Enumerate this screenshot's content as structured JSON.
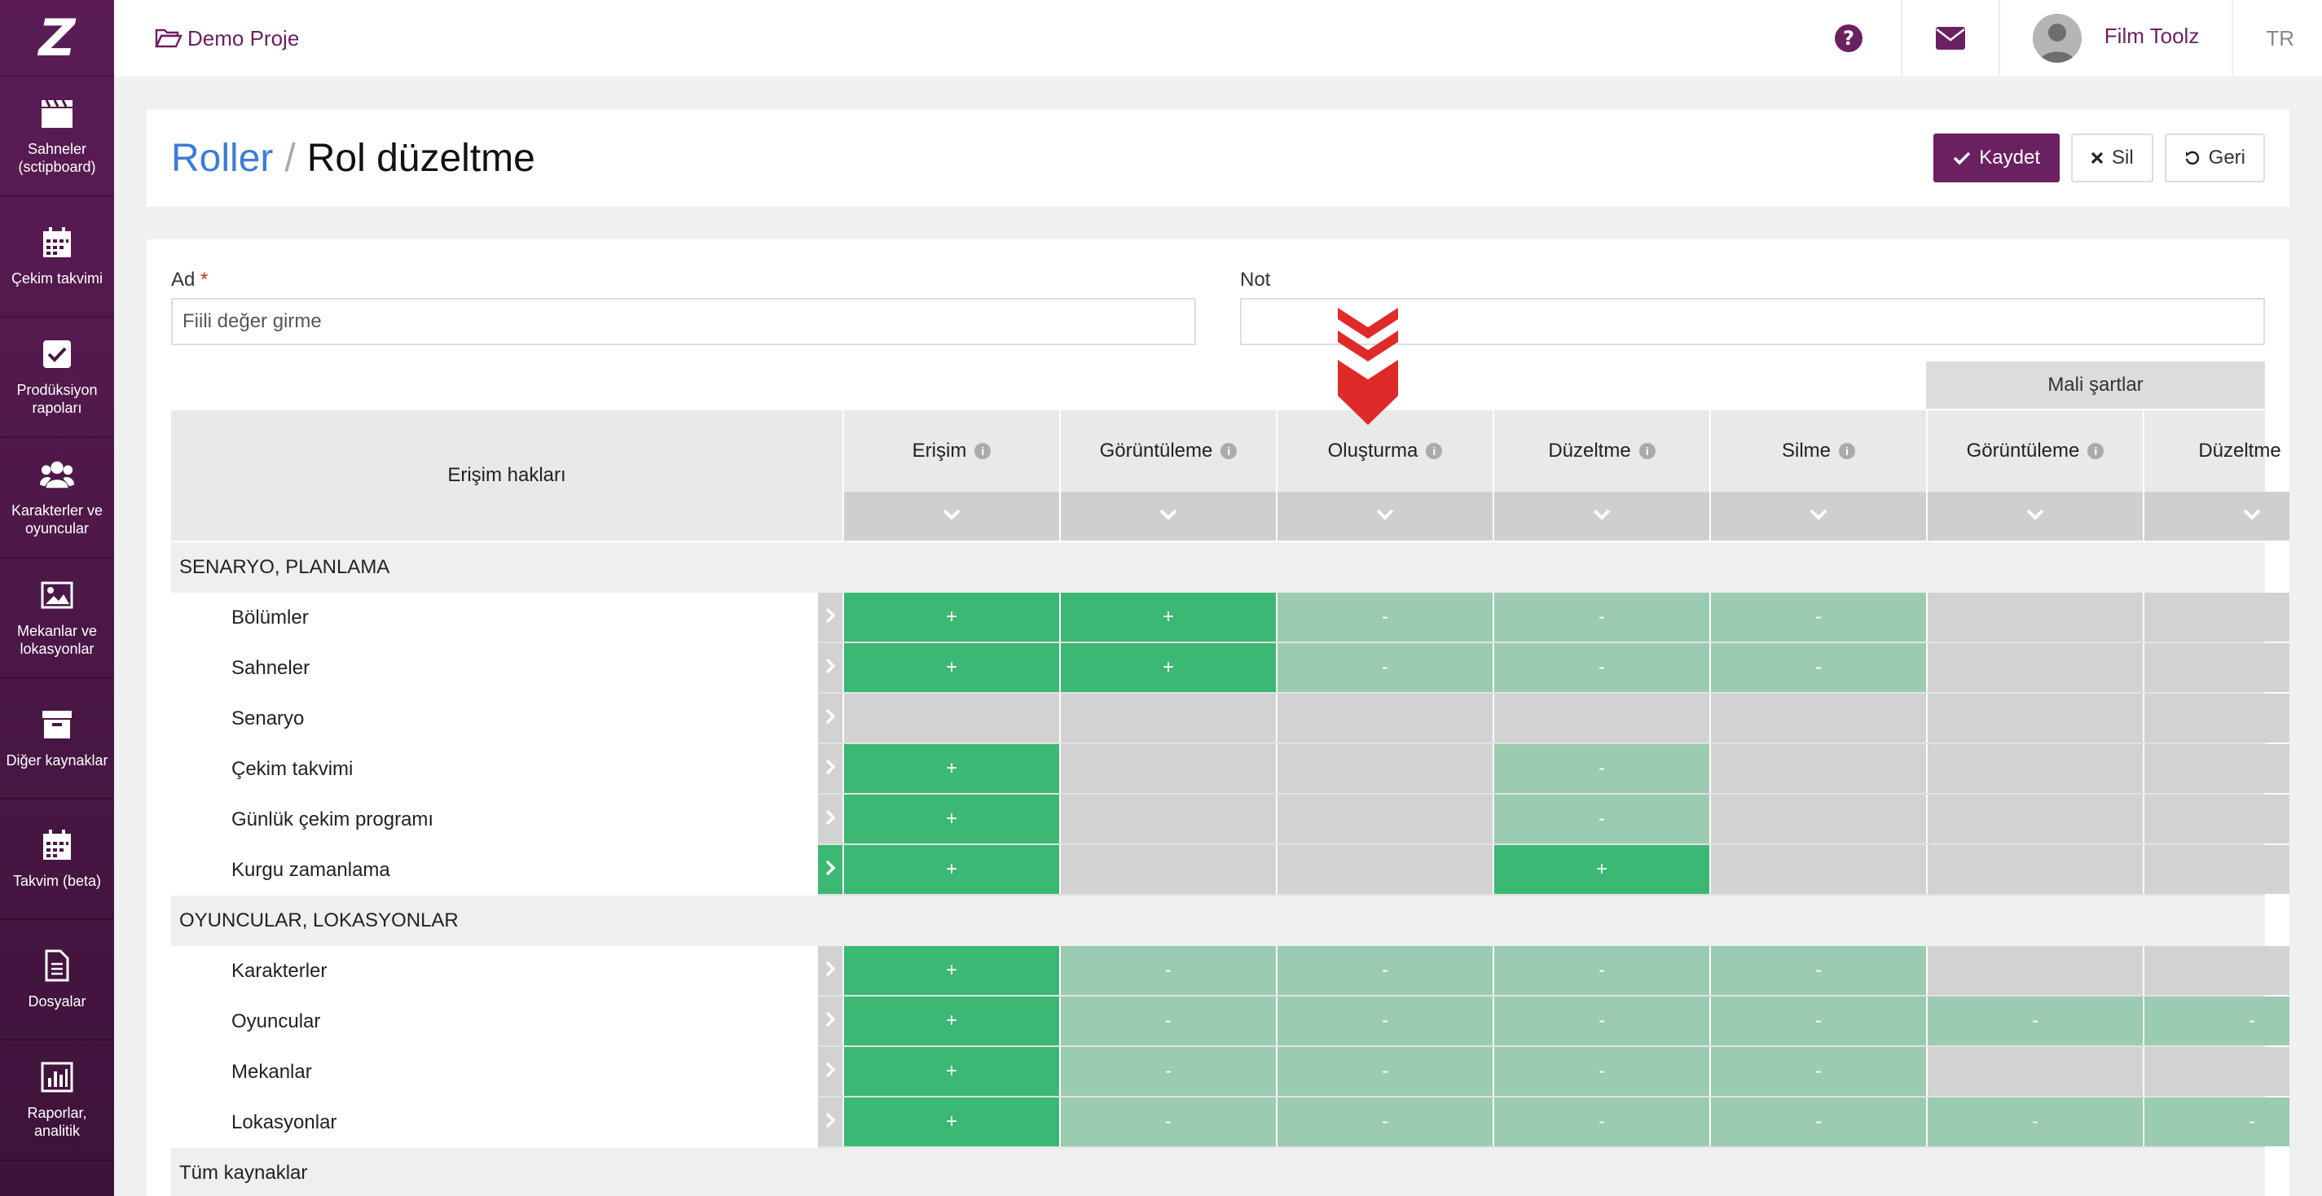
{
  "app": {
    "logo": "Z"
  },
  "sidebar": {
    "items": [
      {
        "label": "Sahneler (sctipboard)",
        "icon": "clapperboard-icon"
      },
      {
        "label": "Çekim takvimi",
        "icon": "calendar-icon"
      },
      {
        "label": "Prodüksiyon rapoları",
        "icon": "checkbox-icon"
      },
      {
        "label": "Karakterler ve oyuncular",
        "icon": "users-icon"
      },
      {
        "label": "Mekanlar ve lokasyonlar",
        "icon": "image-icon"
      },
      {
        "label": "Diğer kaynaklar",
        "icon": "archive-icon"
      },
      {
        "label": "Takvim (beta)",
        "icon": "calendar-icon"
      },
      {
        "label": "Dosyalar",
        "icon": "file-icon"
      },
      {
        "label": "Raporlar, analitik",
        "icon": "bar-chart-icon"
      }
    ]
  },
  "topbar": {
    "project": "Demo Proje",
    "user_name": "Film Toolz",
    "lang": "TR"
  },
  "title": {
    "breadcrumb_link": "Roller",
    "separator": "/",
    "current": "Rol düzeltme"
  },
  "actions": {
    "save": "Kaydet",
    "delete": "Sil",
    "back": "Geri"
  },
  "form": {
    "name_label": "Ad",
    "name_required": "*",
    "name_value": "Fiili değer girme",
    "note_label": "Not",
    "note_value": ""
  },
  "table": {
    "group_header": "Mali şartlar",
    "row_header": "Erişim hakları",
    "columns": [
      "Erişim",
      "Görüntüleme",
      "Oluşturma",
      "Düzeltme",
      "Silme",
      "Görüntüleme",
      "Düzeltme"
    ],
    "sections": [
      {
        "title": "SENARYO, PLANLAMA",
        "rows": [
          {
            "label": "Bölümler",
            "active": false,
            "cells": [
              [
                "on",
                "+"
              ],
              [
                "on",
                "+"
              ],
              [
                "dim",
                "-"
              ],
              [
                "dim",
                "-"
              ],
              [
                "dim",
                "-"
              ],
              [
                "off",
                ""
              ],
              [
                "off",
                ""
              ]
            ]
          },
          {
            "label": "Sahneler",
            "active": false,
            "cells": [
              [
                "on",
                "+"
              ],
              [
                "on",
                "+"
              ],
              [
                "dim",
                "-"
              ],
              [
                "dim",
                "-"
              ],
              [
                "dim",
                "-"
              ],
              [
                "off",
                ""
              ],
              [
                "off",
                ""
              ]
            ]
          },
          {
            "label": "Senaryo",
            "active": false,
            "cells": [
              [
                "off",
                ""
              ],
              [
                "off",
                ""
              ],
              [
                "off",
                ""
              ],
              [
                "off",
                ""
              ],
              [
                "off",
                ""
              ],
              [
                "off",
                ""
              ],
              [
                "off",
                ""
              ]
            ]
          },
          {
            "label": "Çekim takvimi",
            "active": false,
            "cells": [
              [
                "on",
                "+"
              ],
              [
                "off",
                ""
              ],
              [
                "off",
                ""
              ],
              [
                "dim",
                "-"
              ],
              [
                "off",
                ""
              ],
              [
                "off",
                ""
              ],
              [
                "off",
                ""
              ]
            ]
          },
          {
            "label": "Günlük çekim programı",
            "active": false,
            "cells": [
              [
                "on",
                "+"
              ],
              [
                "off",
                ""
              ],
              [
                "off",
                ""
              ],
              [
                "dim",
                "-"
              ],
              [
                "off",
                ""
              ],
              [
                "off",
                ""
              ],
              [
                "off",
                ""
              ]
            ]
          },
          {
            "label": "Kurgu zamanlama",
            "active": true,
            "cells": [
              [
                "on",
                "+"
              ],
              [
                "off",
                ""
              ],
              [
                "off",
                ""
              ],
              [
                "on",
                "+"
              ],
              [
                "off",
                ""
              ],
              [
                "off",
                ""
              ],
              [
                "off",
                ""
              ]
            ]
          }
        ]
      },
      {
        "title": "OYUNCULAR, LOKASYONLAR",
        "rows": [
          {
            "label": "Karakterler",
            "active": false,
            "cells": [
              [
                "on",
                "+"
              ],
              [
                "dim",
                "-"
              ],
              [
                "dim",
                "-"
              ],
              [
                "dim",
                "-"
              ],
              [
                "dim",
                "-"
              ],
              [
                "off",
                ""
              ],
              [
                "off",
                ""
              ]
            ]
          },
          {
            "label": "Oyuncular",
            "active": false,
            "cells": [
              [
                "on",
                "+"
              ],
              [
                "dim",
                "-"
              ],
              [
                "dim",
                "-"
              ],
              [
                "dim",
                "-"
              ],
              [
                "dim",
                "-"
              ],
              [
                "dim",
                "-"
              ],
              [
                "dim",
                "-"
              ]
            ]
          },
          {
            "label": "Mekanlar",
            "active": false,
            "cells": [
              [
                "on",
                "+"
              ],
              [
                "dim",
                "-"
              ],
              [
                "dim",
                "-"
              ],
              [
                "dim",
                "-"
              ],
              [
                "dim",
                "-"
              ],
              [
                "off",
                ""
              ],
              [
                "off",
                ""
              ]
            ]
          },
          {
            "label": "Lokasyonlar",
            "active": false,
            "cells": [
              [
                "on",
                "+"
              ],
              [
                "dim",
                "-"
              ],
              [
                "dim",
                "-"
              ],
              [
                "dim",
                "-"
              ],
              [
                "dim",
                "-"
              ],
              [
                "dim",
                "-"
              ],
              [
                "dim",
                "-"
              ]
            ]
          }
        ]
      },
      {
        "title": "Tüm kaynaklar",
        "rows": []
      }
    ]
  },
  "colors": {
    "brand": "#6b2062",
    "link": "#3b7dd8",
    "cell_on": "#3bb873",
    "cell_dim": "#9bcbb0",
    "cell_off": "#d2d2d2",
    "marker": "#e02a2a"
  }
}
